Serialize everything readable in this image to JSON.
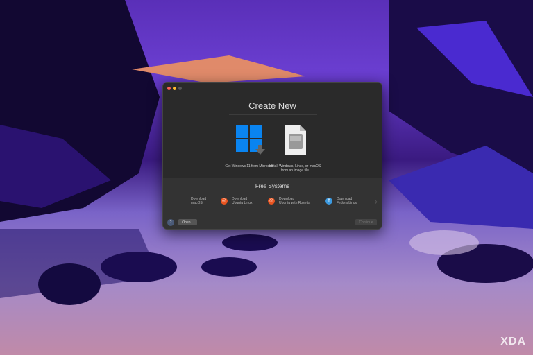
{
  "dialog": {
    "title": "Create New",
    "options": [
      {
        "label": "Get Windows 11 from Microsoft",
        "icon": "windows-download-icon"
      },
      {
        "label": "Install Windows, Linux, or macOS from an image file",
        "icon": "disk-image-icon"
      }
    ],
    "free_systems": {
      "heading": "Free Systems",
      "items": [
        {
          "line1": "Download",
          "line2": "macOS",
          "icon": "apple-icon",
          "color": "#cccccc"
        },
        {
          "line1": "Download",
          "line2": "Ubuntu Linux",
          "icon": "ubuntu-icon",
          "color": "#e95420"
        },
        {
          "line1": "Download",
          "line2": "Ubuntu with Rosetta",
          "icon": "ubuntu-rosetta-icon",
          "color": "#e95420"
        },
        {
          "line1": "Download",
          "line2": "Fedora Linux",
          "icon": "fedora-icon",
          "color": "#3c6eb4"
        }
      ]
    },
    "help_label": "?",
    "open_label": "Open...",
    "continue_label": "Continue"
  },
  "watermark": "XDA"
}
